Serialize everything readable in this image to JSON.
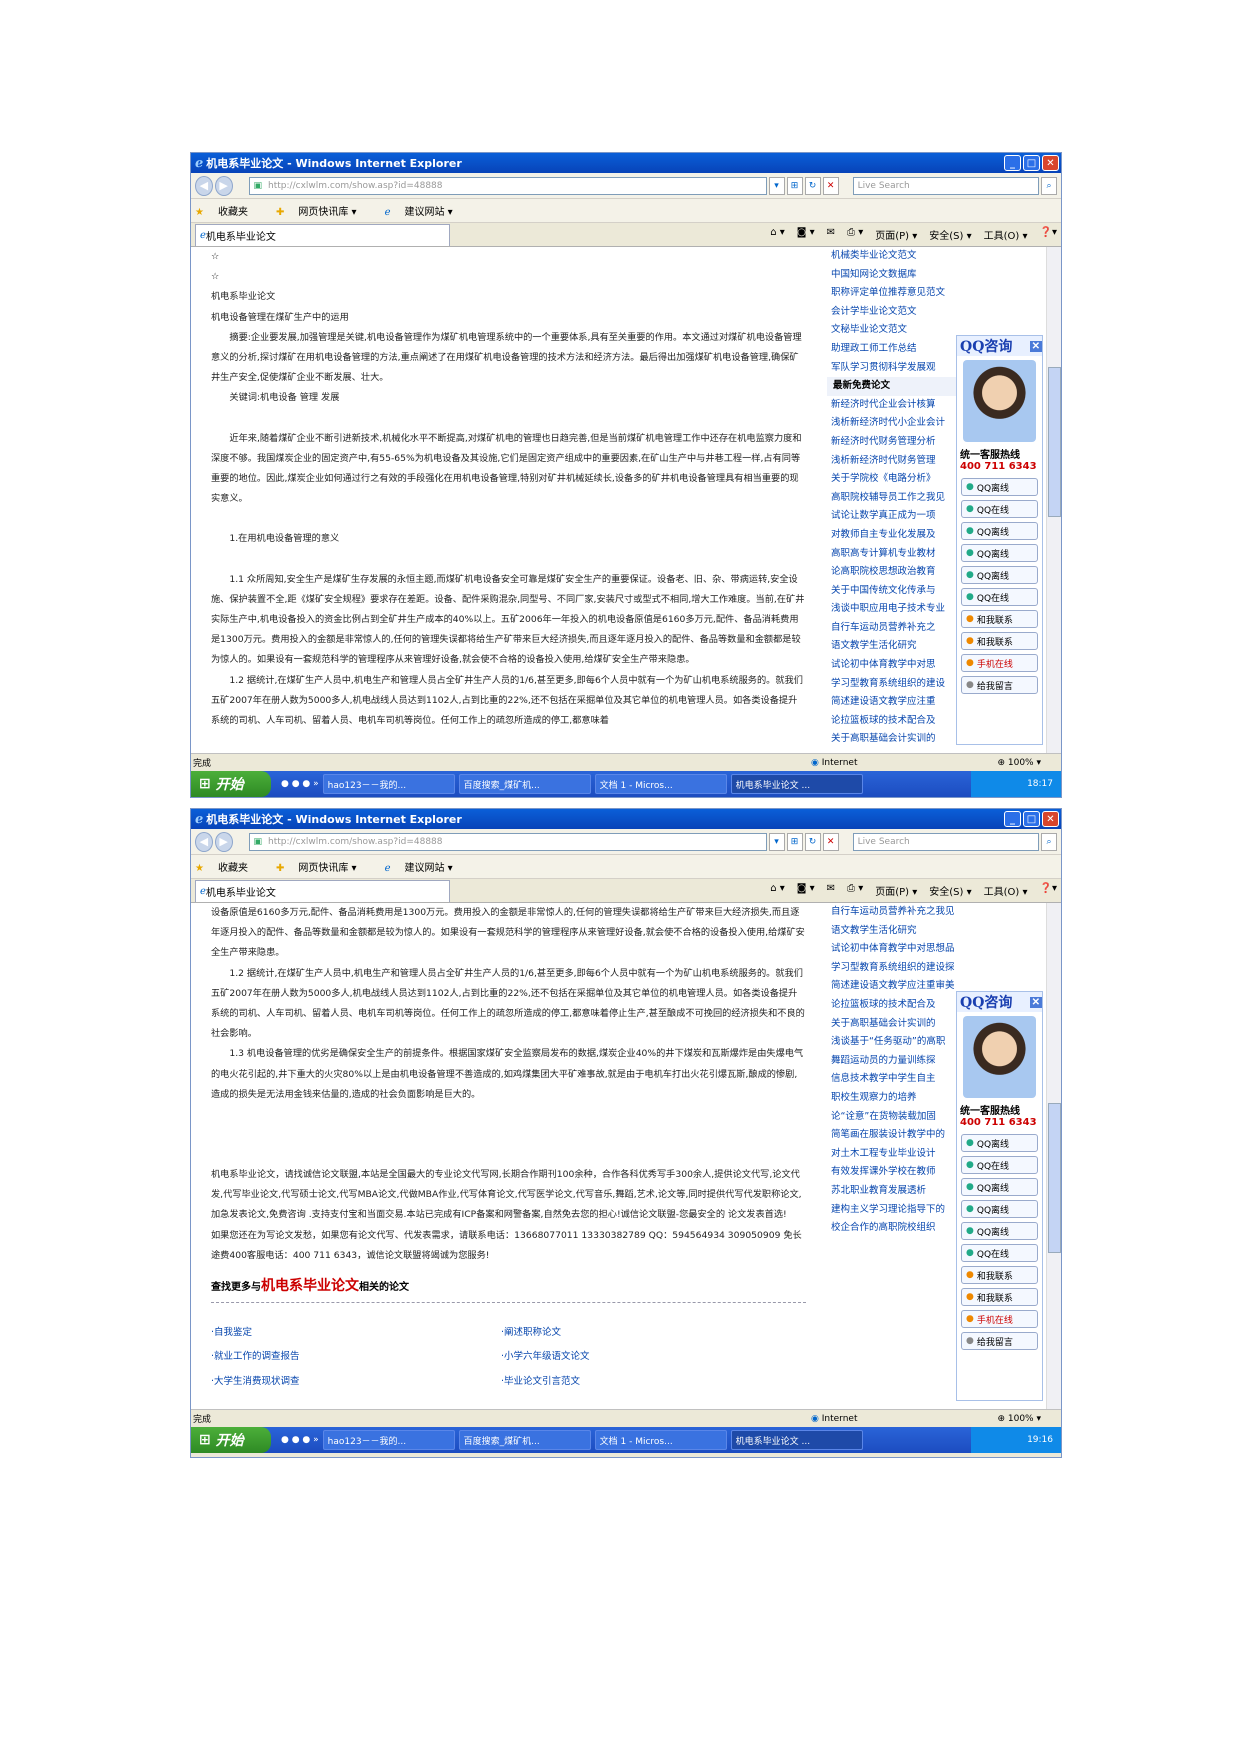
{
  "window": {
    "title": "机电系毕业论文 - Windows Internet Explorer",
    "url": "http://cxlwlm.com/show.asp?id=48888",
    "search_placeholder": "Live Search",
    "tab": "机电系毕业论文"
  },
  "toolbar": {
    "favorites": "收藏夹",
    "quicklib": "网页快讯库 ▾",
    "suggest": "建议网站 ▾",
    "page": "页面(P) ▾",
    "safety": "安全(S) ▾",
    "tools": "工具(O) ▾"
  },
  "status": {
    "done": "完成",
    "zone": "Internet",
    "zoom": "100%"
  },
  "taskbar": {
    "start": "开始",
    "items": [
      "hao123－－我的...",
      "百度搜索_煤矿机...",
      "文档 1 - Micros...",
      "机电系毕业论文 ..."
    ],
    "time1": "18:17",
    "time2": "19:16"
  },
  "qq": {
    "title": "QQ咨询",
    "hotline": "统一客服热线",
    "phone": "400 711 6343",
    "buttons": [
      "QQ离线",
      "QQ在线",
      "QQ离线",
      "QQ离线",
      "QQ离线",
      "QQ在线",
      "和我联系",
      "和我联系",
      "手机在线",
      "给我留言"
    ]
  },
  "shot1": {
    "article": [
      "☆",
      "☆",
      "机电系毕业论文",
      "机电设备管理在煤矿生产中的运用",
      "摘要:企业要发展,加强管理是关键,机电设备管理作为煤矿机电管理系统中的一个重要体系,具有至关重要的作用。本文通过对煤矿机电设备管理意义的分析,探讨煤矿在用机电设备管理的方法,重点阐述了在用煤矿机电设备管理的技术方法和经济方法。最后得出加强煤矿机电设备管理,确保矿井生产安全,促使煤矿企业不断发展、壮大。",
      "关键词:机电设备 管理 发展",
      "",
      "近年来,随着煤矿企业不断引进新技术,机械化水平不断提高,对煤矿机电的管理也日趋完善,但是当前煤矿机电管理工作中还存在机电监察力度和深度不够。我国煤炭企业的固定资产中,有55-65%为机电设备及其设施,它们是固定资产组成中的重要因素,在矿山生产中与井巷工程一样,占有同等重要的地位。因此,煤炭企业如何通过行之有效的手段强化在用机电设备管理,特别对矿井机械延续长,设备多的矿井机电设备管理具有相当重要的现实意义。",
      "",
      "1.在用机电设备管理的意义",
      "",
      "1.1 众所周知,安全生产是煤矿生存发展的永恒主题,而煤矿机电设备安全可靠是煤矿安全生产的重要保证。设备老、旧、杂、带病运转,安全设施、保护装置不全,距《煤矿安全规程》要求存在差距。设备、配件采购混杂,同型号、不同厂家,安装尺寸或型式不相同,增大工作难度。当前,在矿井实际生产中,机电设备投入的资金比例占到全矿井生产成本的40%以上。五矿2006年一年投入的机电设备原值是6160多万元,配件、备品消耗费用是1300万元。费用投入的金额是非常惊人的,任何的管理失误都将给生产矿带来巨大经济损失,而且逐年逐月投入的配件、备品等数量和金额都是较为惊人的。如果设有一套规范科学的管理程序从来管理好设备,就会使不合格的设备投入使用,给煤矿安全生产带来隐患。",
      "1.2 据统计,在煤矿生产人员中,机电生产和管理人员占全矿井生产人员的1/6,甚至更多,即每6个人员中就有一个为矿山机电系统服务的。就我们五矿2007年在册人数为5000多人,机电战线人员达到1102人,占到比重的22%,还不包括在采掘单位及其它单位的机电管理人员。如各类设备提升系统的司机、人车司机、留着人员、电机车司机等岗位。任何工作上的疏忽所造成的停工,都意味着"
    ],
    "sidebar": [
      "机械类毕业论文范文",
      "中国知网论文数据库",
      "职称评定单位推荐意见范文",
      "会计学毕业论文范文",
      "文秘毕业论文范文",
      "助理政工师工作总结",
      "军队学习贯彻科学发展观",
      "最新免费论文",
      "新经济时代企业会计核算",
      "浅析新经济时代小企业会计",
      "新经济时代财务管理分析",
      "浅析新经济时代财务管理",
      "关于学院校《电路分析》",
      "高职院校辅导员工作之我见",
      "试论让数学真正成为一项",
      "对教师自主专业化发展及",
      "高职高专计算机专业教材",
      "论高职院校思想政治教育",
      "关于中国传统文化传承与",
      "浅谈中职应用电子技术专业",
      "自行车运动员营养补充之",
      "语文教学生活化研究",
      "试论初中体育教学中对思",
      "学习型教育系统组织的建设",
      "简述建设语文教学应注重",
      "论拉篮板球的技术配合及",
      "关于高职基础会计实训的"
    ]
  },
  "shot2": {
    "article": [
      "设备原值是6160多万元,配件、备品消耗费用是1300万元。费用投入的金额是非常惊人的,任何的管理失误都将给生产矿带来巨大经济损失,而且逐年逐月投入的配件、备品等数量和金额都是较为惊人的。如果设有一套规范科学的管理程序从来管理好设备,就会使不合格的设备投入使用,给煤矿安全生产带来隐患。",
      "1.2 据统计,在煤矿生产人员中,机电生产和管理人员占全矿井生产人员的1/6,甚至更多,即每6个人员中就有一个为矿山机电系统服务的。就我们五矿2007年在册人数为5000多人,机电战线人员达到1102人,占到比重的22%,还不包括在采掘单位及其它单位的机电管理人员。如各类设备提升系统的司机、人车司机、留着人员、电机车司机等岗位。任何工作上的疏忽所造成的停工,都意味着停止生产,甚至酿成不可挽回的经济损失和不良的社会影响。",
      "1.3 机电设备管理的优劣是确保安全生产的前提条件。根据国家煤矿安全监察局发布的数据,煤炭企业40%的井下煤炭和瓦斯爆炸是由失爆电气的电火花引起的,井下重大的火灾80%以上是由机电设备管理不善造成的,如鸡煤集团大平矿难事故,就是由于电机车打出火花引爆瓦斯,酿成的惨剧,造成的损失是无法用金钱来估量的,造成的社会负面影响是巨大的。",
      "",
      "",
      "",
      "机电系毕业论文，请找诚信论文联盟,本站是全国最大的专业论文代写网,长期合作期刊100余种，合作各科优秀写手300余人,提供论文代写,论文代发,代写毕业论文,代写硕士论文,代写MBA论文,代做MBA作业,代写体育论文,代写医学论文,代写音乐,舞蹈,艺术,论文等,同时提供代写代发职称论文,加急发表论文,免费咨询 .支持支付宝和当面交易.本站已完成有ICP备案和网警备案,自然免去您的担心!诚信论文联盟-您最安全的 论文发表首选!",
      "如果您还在为写论文发愁，如果您有论文代写、代发表需求，请联系电话：13668077011 13330382789 QQ：594564934 309050909 免长途费400客服电话：400 711 6343，诚信论文联盟将竭诚为您服务!"
    ],
    "related_prefix": "查找更多与",
    "related_keyword": "机电系毕业论文",
    "related_suffix": "相关的论文",
    "related": [
      "·自我鉴定",
      "·阐述职称论文",
      "·就业工作的调查报告",
      "·小学六年级语文论文",
      "·大学生消费现状调查",
      "·毕业论文引言范文"
    ],
    "sidebar": [
      "自行车运动员营养补充之我见",
      "语文教学生活化研究",
      "试论初中体育教学中对思想品",
      "学习型教育系统组织的建设探",
      "简述建设语文教学应注重审美",
      "论拉篮板球的技术配合及",
      "关于高职基础会计实训的",
      "浅谈基于“任务驱动”的高职",
      "舞蹈运动员的力量训练探",
      "信息技术教学中学生自主",
      "职校生观察力的培养",
      "论“诠意”在货物装载加固",
      "简笔画在服装设计教学中的",
      "对土木工程专业毕业设计",
      "有效发挥课外学校在教师",
      "苏北职业教育发展透析",
      "建构主义学习理论指导下的",
      "校企合作的高职院校组织"
    ]
  }
}
